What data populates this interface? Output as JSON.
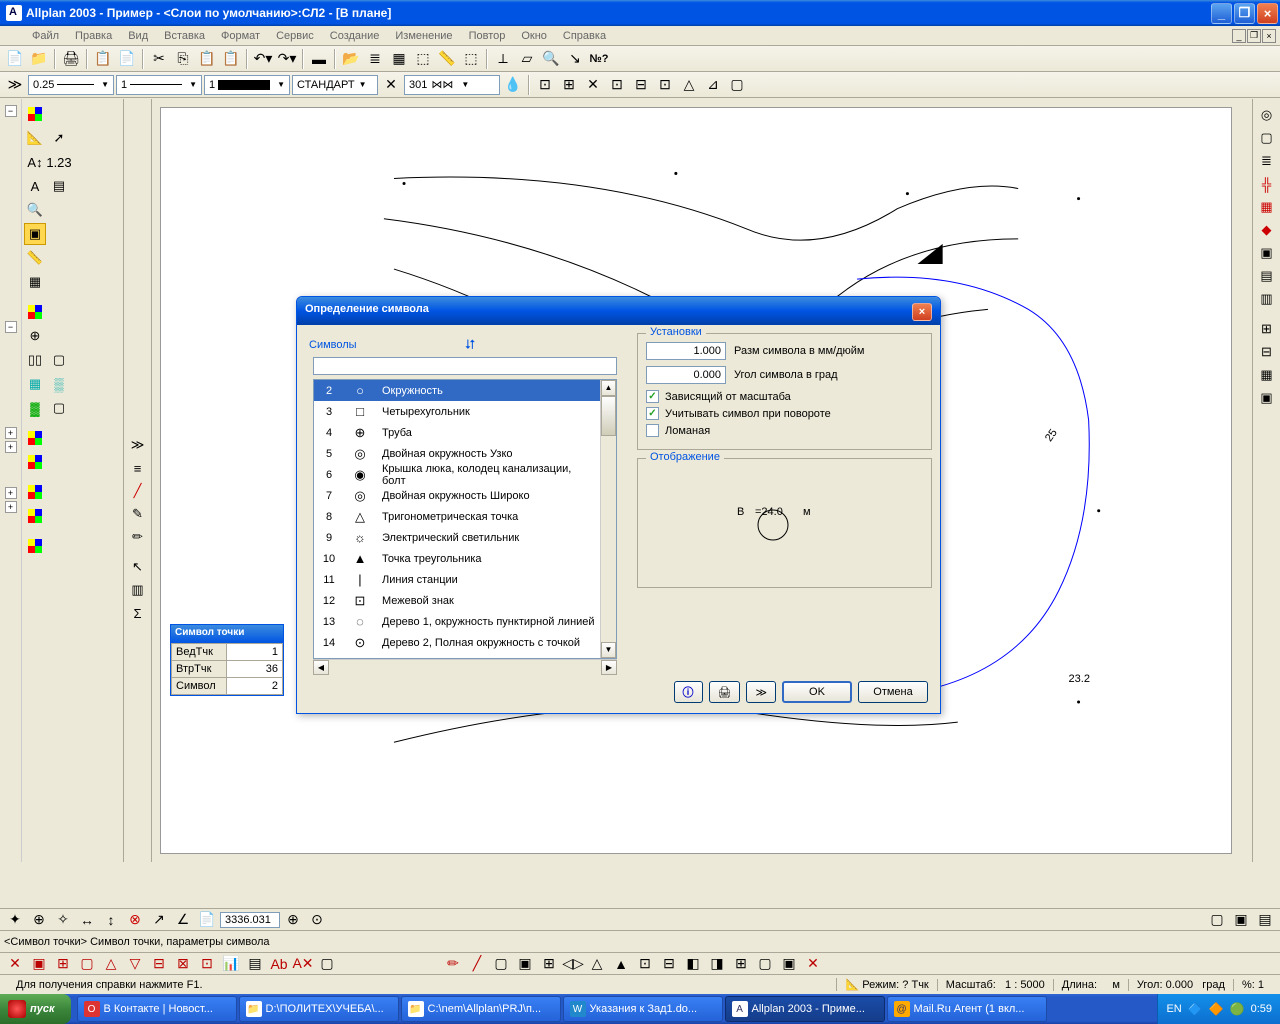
{
  "title": "Allplan 2003 - Пример - <Слои по умолчанию>:СЛ2 - [В плане]",
  "menu": [
    "Файл",
    "Правка",
    "Вид",
    "Вставка",
    "Формат",
    "Сервис",
    "Создание",
    "Изменение",
    "Повтор",
    "Окно",
    "Справка"
  ],
  "tb2": {
    "lineweight": "0.25",
    "linetype": "1",
    "color": "1",
    "layer": "СТАНДАРТ",
    "penset": "301"
  },
  "dialog": {
    "title": "Определение символа",
    "symbols_label": "Символы",
    "settings_label": "Установки",
    "size_label": "Разм символа в мм/дюйм",
    "size_val": "1.000",
    "angle_label": "Угол символа в град",
    "angle_val": "0.000",
    "cb1": "Зависящий от масштаба",
    "cb2": "Учитывать символ при повороте",
    "cb3": "Ломаная",
    "display_label": "Отображение",
    "preview_text_left": "В",
    "preview_text_center": "=24.0",
    "preview_text_right": "м",
    "ok": "OK",
    "cancel": "Отмена",
    "items": [
      {
        "n": "2",
        "name": "Окружность"
      },
      {
        "n": "3",
        "name": "Четырехугольник"
      },
      {
        "n": "4",
        "name": "Труба"
      },
      {
        "n": "5",
        "name": "Двойная окружность Узко"
      },
      {
        "n": "6",
        "name": "Крышка люка, колодец канализации, болт"
      },
      {
        "n": "7",
        "name": "Двойная окружность Широко"
      },
      {
        "n": "8",
        "name": "Тригонометрическая точка"
      },
      {
        "n": "9",
        "name": "Электрический светильник"
      },
      {
        "n": "10",
        "name": "Точка треугольника"
      },
      {
        "n": "11",
        "name": "Линия станции"
      },
      {
        "n": "12",
        "name": "Межевой знак"
      },
      {
        "n": "13",
        "name": "Дерево 1, окружность пунктирной линией"
      },
      {
        "n": "14",
        "name": "Дерево 2, Полная окружность с точкой"
      }
    ]
  },
  "floatpal": {
    "title": "Символ точки",
    "rows": [
      {
        "k": "ВедТчк",
        "v": "1"
      },
      {
        "k": "ВтрТчк",
        "v": "36"
      },
      {
        "k": "Символ",
        "v": "2"
      }
    ]
  },
  "canvas_label_232": "23.2",
  "canvas_label_25": "25",
  "bottombar": {
    "coord": "3336.031"
  },
  "hintbar": "<Символ точки> Символ точки, параметры символа",
  "status": {
    "help": "Для получения справки нажмите F1.",
    "mode_l": "Режим:",
    "mode_v": "? Тчк",
    "scale_l": "Масштаб:",
    "scale_v": "1 : 5000",
    "length_l": "Длина:",
    "length_v": "м",
    "angle_l": "Угол:",
    "angle_v": "0.000",
    "angle_u": "град",
    "pct_l": "%:",
    "pct_v": "1"
  },
  "taskbar": {
    "start": "пуск",
    "tasks": [
      "В Контакте | Новост...",
      "D:\\ПОЛИТЕХ\\УЧЕБА\\...",
      "C:\\nem\\Allplan\\PRJ\\п...",
      "Указания к Зад1.do...",
      "Allplan 2003 - Приме...",
      "Mail.Ru Агент (1 вкл..."
    ],
    "lang": "EN",
    "time": "0:59"
  }
}
